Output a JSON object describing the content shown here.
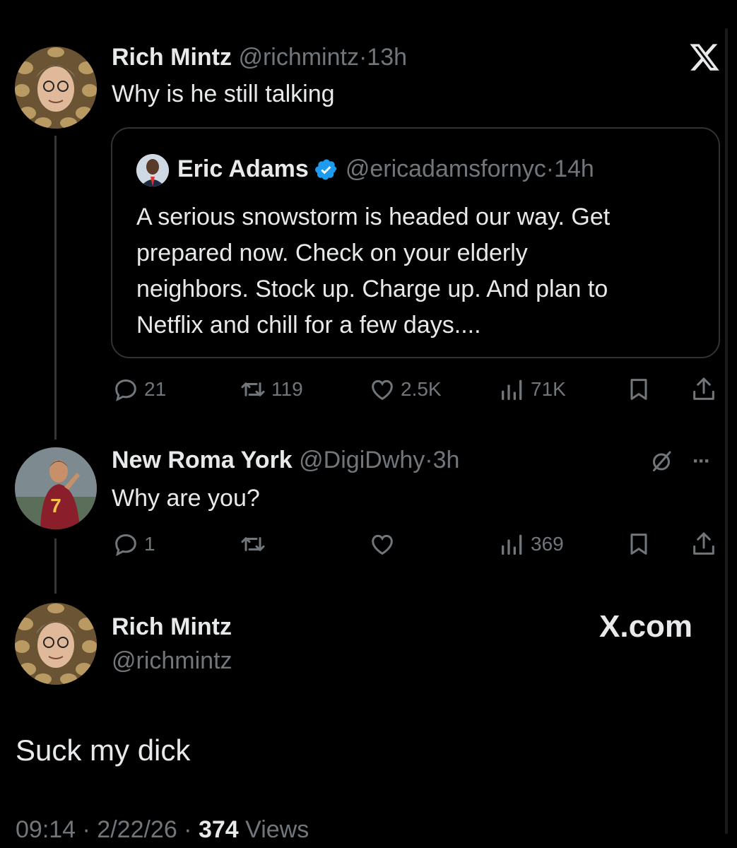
{
  "tweet1": {
    "name": "Rich Mintz",
    "handle": "@richmintz",
    "sep": "·",
    "time": "13h",
    "text": "Why is he still talking",
    "quote": {
      "name": "Eric Adams",
      "handle": "@ericadamsfornyc",
      "sep": "·",
      "time": "14h",
      "text_lines": [
        "A serious snowstorm is headed our way. Get",
        "prepared now. Check on your elderly",
        "neighbors. Stock up. Charge up. And plan to",
        "Netflix and chill for a few days...."
      ]
    },
    "replies": "21",
    "reposts": "119",
    "likes": "2.5K",
    "views": "71K"
  },
  "tweet2": {
    "name": "New Roma York",
    "handle": "@DigiDwhy",
    "sep": "·",
    "time": "3h",
    "text": "Why are you?",
    "replies": "1",
    "views": "369",
    "more": "···"
  },
  "tweet3": {
    "name": "Rich Mintz",
    "handle": "@richmintz",
    "text": "Suck my dick",
    "timestamp": "09:14 · 2/22/26 · ",
    "view_count": "374",
    "views_label": " Views"
  },
  "brand": {
    "logo_glyph": "X",
    "watermark": "X.com"
  },
  "colors": {
    "background": "#000000",
    "text": "#e7e9ea",
    "muted": "#71767b",
    "verified": "#1d9bf0",
    "border": "#2f3336"
  },
  "icons": [
    "x-logo-icon",
    "verified-badge-icon",
    "reply-icon",
    "repost-icon",
    "like-icon",
    "views-icon",
    "bookmark-icon",
    "share-icon",
    "grok-icon",
    "more-icon"
  ]
}
